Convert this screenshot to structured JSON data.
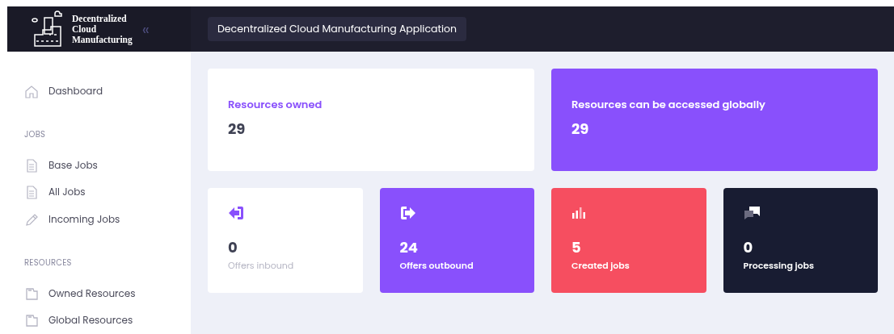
{
  "logo": {
    "lines": [
      "Decentralized",
      "Cloud",
      "Manufacturing"
    ]
  },
  "collapse_icon": "«",
  "header": {
    "title": "Decentralized Cloud Manufacturing Application"
  },
  "sidebar": {
    "items": [
      {
        "kind": "link",
        "label": "Dashboard"
      },
      {
        "kind": "heading",
        "label": "JOBS"
      },
      {
        "kind": "link",
        "label": "Base Jobs"
      },
      {
        "kind": "link",
        "label": "All Jobs"
      },
      {
        "kind": "link",
        "label": "Incoming Jobs"
      },
      {
        "kind": "heading",
        "label": "RESOURCES"
      },
      {
        "kind": "link",
        "label": "Owned Resources"
      },
      {
        "kind": "link",
        "label": "Global Resources"
      }
    ]
  },
  "summary_cards": [
    {
      "kind": "light",
      "label": "Resources owned",
      "value": "29"
    },
    {
      "kind": "purple",
      "label": "Resources can be accessed globally",
      "value": "29"
    }
  ],
  "stat_cards": [
    {
      "kind": "light",
      "value": "0",
      "label": "Offers inbound"
    },
    {
      "kind": "purple",
      "value": "24",
      "label": "Offers outbound"
    },
    {
      "kind": "red",
      "value": "5",
      "label": "Created jobs"
    },
    {
      "kind": "dark",
      "value": "0",
      "label": "Processing jobs"
    }
  ]
}
